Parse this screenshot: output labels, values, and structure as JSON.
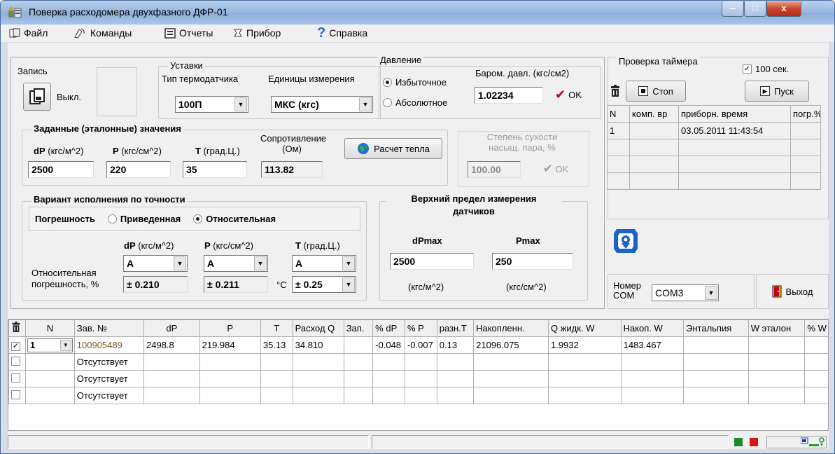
{
  "window": {
    "title": "Поверка расходомера двухфазного ДФР-01",
    "min": "‒",
    "max": "□",
    "close": "x"
  },
  "menu": [
    {
      "label": "Файл",
      "icon": "file-icon"
    },
    {
      "label": "Команды",
      "icon": "commands-icon"
    },
    {
      "label": "Отчеты",
      "icon": "reports-icon"
    },
    {
      "label": "Прибор",
      "icon": "device-icon"
    },
    {
      "label": "Справка",
      "icon": "help-icon"
    }
  ],
  "record": {
    "group": "Запись",
    "state": "Выкл."
  },
  "setpoints": {
    "group": "Уставки",
    "sensor_type_label": "Тип термодатчика",
    "sensor_type_value": "100П",
    "units_label": "Единицы измерения",
    "units_value": "МКС (кгс)"
  },
  "pressure": {
    "group": "Давление",
    "gauge": "Избыточное",
    "absolute": "Абсолютное",
    "baro_label": "Баром. давл. (кгс/см2)",
    "baro_value": "1.02234",
    "ok": "OK"
  },
  "reference": {
    "group": "Заданные (эталонные) значения",
    "dp_label_b": "dP",
    "dp_label": "(кгс/м^2)",
    "p_label_b": "P",
    "p_label": "(кгс/см^2)",
    "t_label_b": "T",
    "t_label": "(град.Ц.)",
    "res_label1": "Сопротивление",
    "res_label2": "(Ом)",
    "dp_value": "2500",
    "p_value": "220",
    "t_value": "35",
    "res_value": "113.82",
    "heat_button": "Расчет тепла"
  },
  "dryness": {
    "label1": "Степень сухости",
    "label2": "насыщ. пара, %",
    "value": "100.00",
    "ok": "OK"
  },
  "accuracy": {
    "group": "Вариант исполнения по точности",
    "error_label": "Погрешность",
    "reduced": "Приведенная",
    "relative": "Относительная",
    "dp_b": "dP",
    "dp_u": "(кгс/м^2)",
    "p_b": "P",
    "p_u": "(кгс/см^2)",
    "t_b": "T",
    "t_u": "(град.Ц.)",
    "rel_label1": "Относительная",
    "rel_label2": "погрешность, %",
    "dp_class": "А",
    "p_class": "А",
    "t_class": "А",
    "dp_err": "± 0.210",
    "p_err": "± 0.211",
    "t_unit": "°С",
    "t_err": "± 0.25"
  },
  "upper_limit": {
    "group1": "Верхний предел измерения",
    "group2": "датчиков",
    "dpmax_label": "dPmax",
    "pmax_label": "Pmax",
    "dpmax_value": "2500",
    "pmax_value": "250",
    "dpmax_unit": "(кгс/м^2)",
    "pmax_unit": "(кгс/см^2)"
  },
  "timer": {
    "group": "Проверка таймера",
    "checkbox_label": "100 сек.",
    "stop": "Стоп",
    "start": "Пуск",
    "columns": [
      "N",
      "комп. вр",
      "приборн. время",
      "погр.%"
    ],
    "rows": [
      [
        "1",
        "",
        "03.05.2011 11:43:54",
        ""
      ],
      [
        "",
        "",
        "",
        ""
      ],
      [
        "",
        "",
        "",
        ""
      ],
      [
        "",
        "",
        "",
        ""
      ]
    ]
  },
  "com": {
    "label1": "Номер",
    "label2": "COM",
    "value": "COM3",
    "exit": "Выход"
  },
  "main_table": {
    "col_n": "N",
    "columns": [
      "Зав. №",
      "dP",
      "P",
      "T",
      "Расход Q",
      "Зап.",
      "% dP",
      "% P",
      "разн.T",
      "Накопленн.",
      "Q жидк. W",
      "Накоп. W",
      "Энтальпия",
      "W эталон",
      "% W"
    ],
    "rows": [
      [
        "100905489",
        "2498.8",
        "219.984",
        "35.13",
        "34.810",
        "",
        "-0.048",
        "-0.007",
        "0.13",
        "21096.075",
        "1.9932",
        "1483.467",
        "",
        "",
        ""
      ],
      [
        "Отсутствует",
        "",
        "",
        "",
        "",
        "",
        "",
        "",
        "",
        "",
        "",
        "",
        "",
        "",
        ""
      ],
      [
        "Отсутствует",
        "",
        "",
        "",
        "",
        "",
        "",
        "",
        "",
        "",
        "",
        "",
        "",
        "",
        ""
      ],
      [
        "Отсутствует",
        "",
        "",
        "",
        "",
        "",
        "",
        "",
        "",
        "",
        "",
        "",
        "",
        "",
        ""
      ]
    ],
    "first_row_n": "1"
  }
}
